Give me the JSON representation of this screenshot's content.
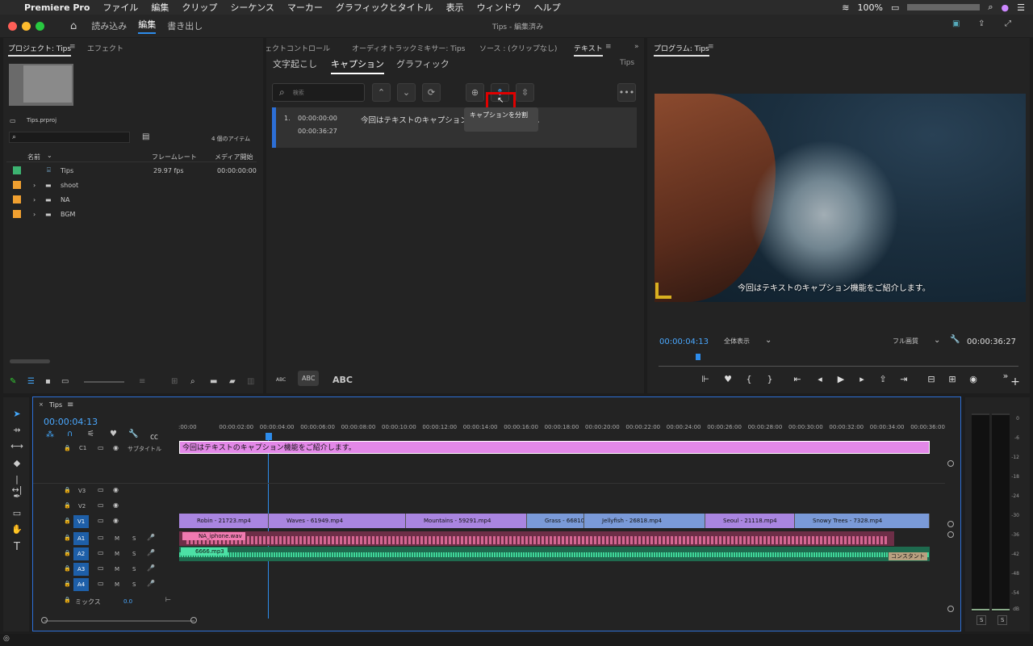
{
  "menubar": {
    "app": "Premiere Pro",
    "items": [
      "ファイル",
      "編集",
      "クリップ",
      "シーケンス",
      "マーカー",
      "グラフィックとタイトル",
      "表示",
      "ウィンドウ",
      "ヘルプ"
    ],
    "battery": "100%"
  },
  "titlebar": {
    "workspaces": [
      "読み込み",
      "編集",
      "書き出し"
    ],
    "title": "Tips - 編集済み"
  },
  "project": {
    "tab": "プロジェクト: Tips",
    "tab2": "エフェクト",
    "file": "Tips.prproj",
    "count": "4 個のアイテム",
    "col_name": "名前",
    "col_fps": "フレームレート",
    "col_start": "メディア開始",
    "items": [
      {
        "name": "Tips",
        "fps": "29.97 fps",
        "start": "00:00:00:00",
        "color": "#3cb371"
      },
      {
        "name": "shoot",
        "fps": "",
        "start": "",
        "color": "#f0a030"
      },
      {
        "name": "NA",
        "fps": "",
        "start": "",
        "color": "#f0a030"
      },
      {
        "name": "BGM",
        "fps": "",
        "start": "",
        "color": "#f0a030"
      }
    ]
  },
  "center": {
    "tabs": [
      "ェクトコントロール",
      "オーディオトラックミキサー: Tips",
      "ソース : (クリップなし)",
      "テキスト"
    ],
    "subtabs": [
      "文字起こし",
      "キャプション",
      "グラフィック"
    ],
    "seq": "Tips",
    "search_placeholder": "検索",
    "caption": {
      "index": "1.",
      "in": "00:00:00:00",
      "out": "00:00:36:27",
      "text": "今回はテキストのキャプション機能をご紹介します。"
    },
    "tooltip": "キャプションを分割",
    "abc": [
      "ABC",
      "ABC",
      "ABC"
    ]
  },
  "program": {
    "tab": "プログラム: Tips",
    "subtitle": "今回はテキストのキャプション機能をご紹介します。",
    "time": "00:00:04:13",
    "zoom": "全体表示",
    "quality": "フル画質",
    "duration": "00:00:36:27"
  },
  "timeline": {
    "tab": "Tips",
    "time": "00:00:04:13",
    "caption_track": "サブタイトル",
    "c1": "C1",
    "ticks": [
      ":00:00",
      "00:00:02:00",
      "00:00:04:00",
      "00:00:06:00",
      "00:00:08:00",
      "00:00:10:00",
      "00:00:12:00",
      "00:00:14:00",
      "00:00:16:00",
      "00:00:18:00",
      "00:00:20:00",
      "00:00:22:00",
      "00:00:24:00",
      "00:00:26:00",
      "00:00:28:00",
      "00:00:30:00",
      "00:00:32:00",
      "00:00:34:00",
      "00:00:36:00"
    ],
    "caption_clip": "今回はテキストのキャプション機能をご紹介します。",
    "video_tracks": [
      "V3",
      "V2",
      "V1"
    ],
    "audio_tracks": [
      "A1",
      "A2",
      "A3",
      "A4"
    ],
    "mix": "ミックス",
    "mix_val": "0.0",
    "v1_clips": [
      "Robin - 21723.mp4",
      "Waves - 61949.mp4",
      "Mountains - 59291.mp4",
      "Grass - 66810.",
      "Jellyfish - 26818.mp4",
      "Seoul - 21118.mp4",
      "Snowy Trees - 7328.mp4"
    ],
    "a1_clip": "NA_iphone.wav",
    "a2_clip": "6666.mp3",
    "a2_end": "コンスタント"
  },
  "meter": {
    "labels": [
      "0",
      "-6",
      "-12",
      "-18",
      "-24",
      "-30",
      "-36",
      "-42",
      "-48",
      "-54",
      "dB"
    ],
    "s": [
      "S",
      "S"
    ]
  }
}
